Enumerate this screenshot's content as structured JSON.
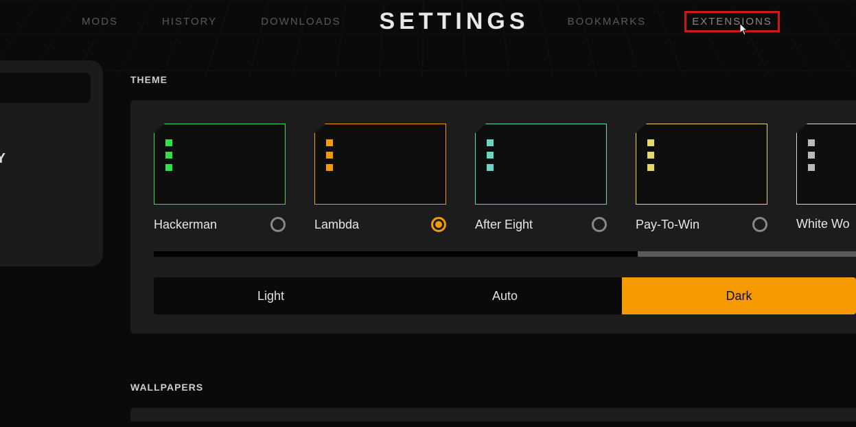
{
  "nav": {
    "items": [
      "MODS",
      "HISTORY",
      "DOWNLOADS"
    ],
    "title": "SETTINGS",
    "items_right": [
      "BOOKMARKS",
      "EXTENSIONS"
    ],
    "highlighted": "EXTENSIONS"
  },
  "sidebar": {
    "visible_label": "URITY"
  },
  "sections": {
    "theme": {
      "title": "THEME",
      "themes": [
        {
          "name": "Hackerman",
          "accent": "#2ee04a",
          "dots": "#2ee04a",
          "selected": false
        },
        {
          "name": "Lambda",
          "accent": "#f59a00",
          "dots": "#f59a00",
          "selected": true
        },
        {
          "name": "After Eight",
          "accent": "#5fd7c6",
          "dots": "#6ed5c4",
          "selected": false
        },
        {
          "name": "Pay-To-Win",
          "accent": "#e9d66b",
          "dots": "#e9d66b",
          "selected": false
        },
        {
          "name": "White Wo",
          "accent": "#d8d8d8",
          "dots": "#b9b9b9",
          "selected": false
        }
      ],
      "modes": [
        "Light",
        "Auto",
        "Dark"
      ],
      "active_mode": "Dark"
    },
    "wallpapers": {
      "title": "WALLPAPERS"
    }
  }
}
